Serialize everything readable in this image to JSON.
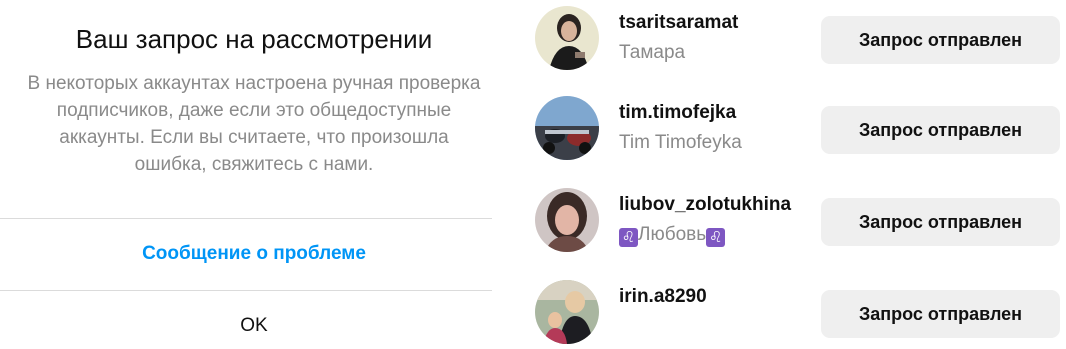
{
  "dialog": {
    "title": "Ваш запрос на рассмотрении",
    "body": "В некоторых аккаунтах настроена ручная проверка\nподписчиков, даже если это общедоступные\nаккаунты. Если вы считаете, что произошла\nошибка, свяжитесь с нами.",
    "report_label": "Сообщение о проблеме",
    "ok_label": "OK"
  },
  "requests": [
    {
      "username": "tsaritsaramat",
      "full_name": "Тамара",
      "button_label": "Запрос отправлен"
    },
    {
      "username": "tim.timofejka",
      "full_name": "Tim Timofeyka",
      "button_label": "Запрос отправлен"
    },
    {
      "username": "liubov_zolotukhina",
      "full_name": "Любовь",
      "full_name_prefix_icon": "leo-sign-icon",
      "full_name_suffix_icon": "leo-sign-icon",
      "button_label": "Запрос отправлен"
    },
    {
      "username": "irin.a8290",
      "full_name": "",
      "button_label": "Запрос отправлен"
    }
  ],
  "colors": {
    "link_blue": "#0095f6",
    "secondary_text": "#8a8a8a",
    "button_bg": "#efefef",
    "divider": "#dbdbdb"
  }
}
